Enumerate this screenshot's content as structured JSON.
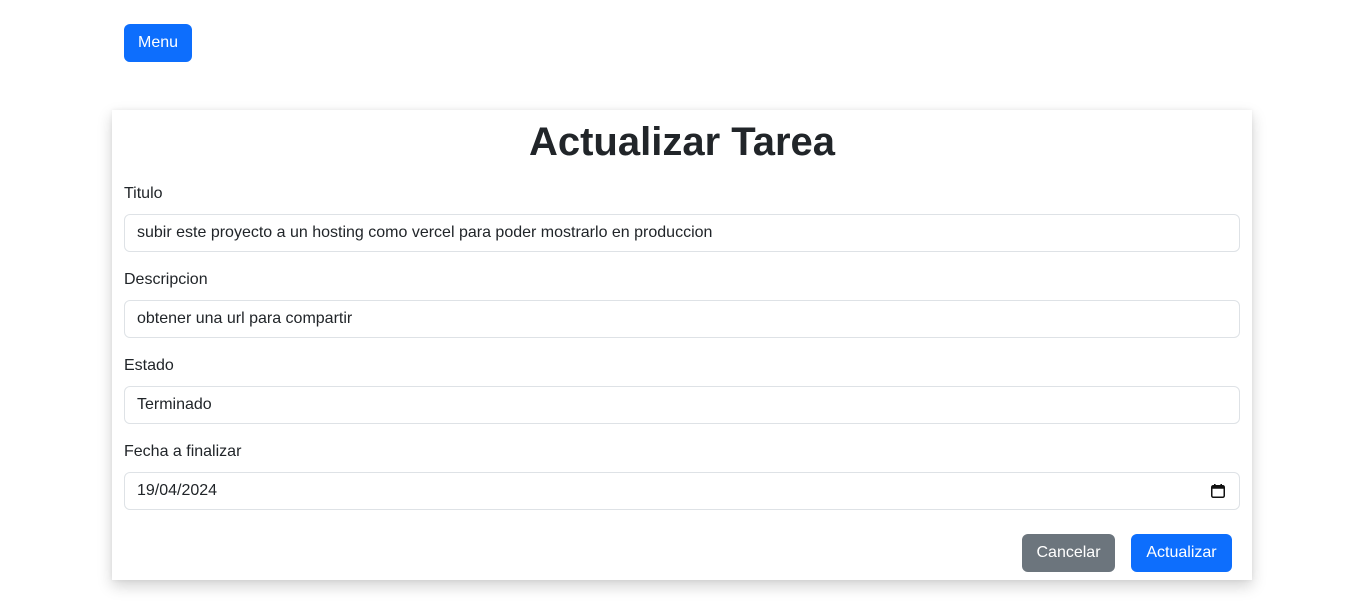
{
  "nav": {
    "menu_label": "Menu"
  },
  "form": {
    "title": "Actualizar Tarea",
    "fields": {
      "titulo": {
        "label": "Titulo",
        "value": "subir este proyecto a un hosting como vercel para poder mostrarlo en produccion"
      },
      "descripcion": {
        "label": "Descripcion",
        "value": "obtener una url para compartir"
      },
      "estado": {
        "label": "Estado",
        "value": "Terminado"
      },
      "fecha": {
        "label": "Fecha a finalizar",
        "value": "19/04/2024",
        "icon": "calendar-icon"
      }
    },
    "actions": {
      "cancel_label": "Cancelar",
      "update_label": "Actualizar"
    }
  },
  "colors": {
    "primary": "#0d6efd",
    "secondary": "#6c757d",
    "text": "#212529",
    "border": "#dee2e6"
  }
}
